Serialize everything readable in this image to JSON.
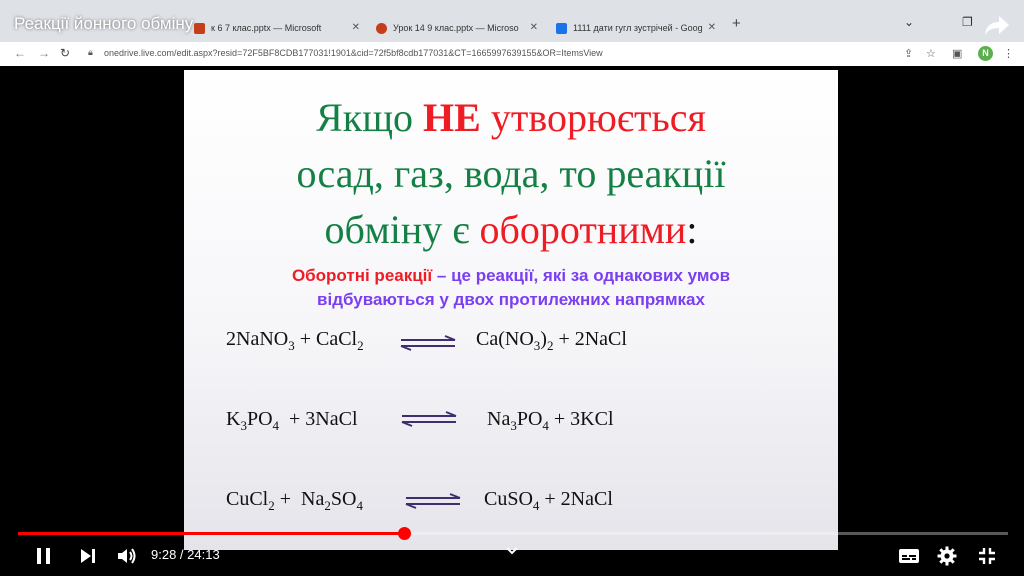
{
  "video": {
    "title": "Реакції йонного обміну",
    "current_time": "9:28",
    "separator": " / ",
    "duration": "24:13",
    "progress_fraction": 0.39
  },
  "browser": {
    "tabs": [
      {
        "label": "к 6 7 клас.pptx — Microsoft",
        "favicon_color": "#c43e1c"
      },
      {
        "label": "Урок 14 9 клас.pptx — Microso",
        "favicon_color": "#c43e1c"
      },
      {
        "label": "1111 дати гугл зустрічей - Goog",
        "favicon_color": "#1a73e8"
      }
    ],
    "url": "onedrive.live.com/edit.aspx?resid=72F5BF8CDB177031!1901&cid=72f5bf8cdb177031&CT=1665997639155&OR=ItemsView",
    "profile_initial": "N"
  },
  "slide": {
    "line1_a": "Якщо ",
    "line1_b": "НЕ",
    "line1_c": " утворюється",
    "line2": "осад, газ, вода, то реакції",
    "line3_a": "обміну є ",
    "line3_b": "оборотними",
    "line3_c": ":",
    "defn_a": "Оборотні реакції",
    "defn_b": " – це реакції, які за однакових умов",
    "defn_c": "відбуваються у двох протилежних напрямках"
  },
  "colors": {
    "heading_green": "#148045",
    "accent_red": "#ee1c24",
    "definition_purple": "#7b3ff0",
    "progress_red": "#ff0000"
  },
  "icons": [
    "pause-icon",
    "next-icon",
    "volume-icon",
    "subtitles-icon",
    "settings-icon",
    "exit-fullscreen-icon",
    "share-icon",
    "chevron-down-icon"
  ]
}
